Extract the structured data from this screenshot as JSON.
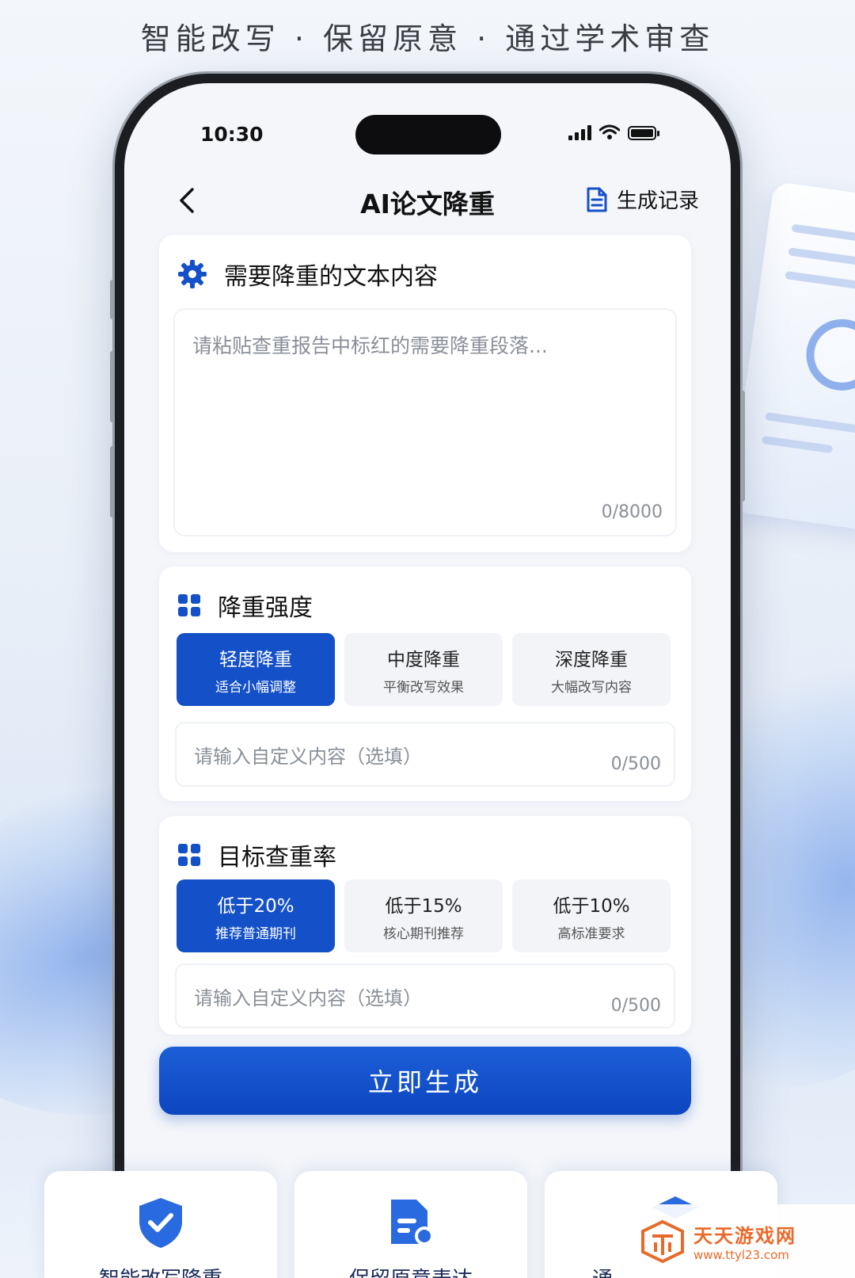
{
  "tagline": "智能改写 · 保留原意 · 通过学术审查",
  "status_bar": {
    "time": "10:30"
  },
  "nav": {
    "title": "AI论文降重",
    "history_label": "生成记录"
  },
  "text_section": {
    "title": "需要降重的文本内容",
    "placeholder": "请粘贴查重报告中标红的需要降重段落...",
    "counter": "0/8000"
  },
  "intensity_section": {
    "title": "降重强度",
    "options": [
      {
        "label": "轻度降重",
        "desc": "适合小幅调整"
      },
      {
        "label": "中度降重",
        "desc": "平衡改写效果"
      },
      {
        "label": "深度降重",
        "desc": "大幅改写内容"
      }
    ],
    "selected": "轻度降重",
    "custom_placeholder": "请输入自定义内容（选填）",
    "custom_counter": "0/500"
  },
  "target_section": {
    "title": "目标查重率",
    "options": [
      {
        "label": "低于20%",
        "desc": "推荐普通期刊"
      },
      {
        "label": "低于15%",
        "desc": "核心期刊推荐"
      },
      {
        "label": "低于10%",
        "desc": "高标准要求"
      }
    ],
    "selected": "低于20%",
    "custom_placeholder": "请输入自定义内容（选填）",
    "custom_counter": "0/500"
  },
  "generate_label": "立即生成",
  "features": [
    {
      "label": "智能改写降重",
      "icon": "shield-check-icon"
    },
    {
      "label": "保留原意表达",
      "icon": "document-chat-icon"
    },
    {
      "label": "通",
      "icon": "cap-icon"
    }
  ],
  "watermark": {
    "name": "天天游戏网",
    "url": "www.ttyl23.com"
  },
  "colors": {
    "accent": "#1450c8",
    "watermark": "#e86a2a"
  }
}
